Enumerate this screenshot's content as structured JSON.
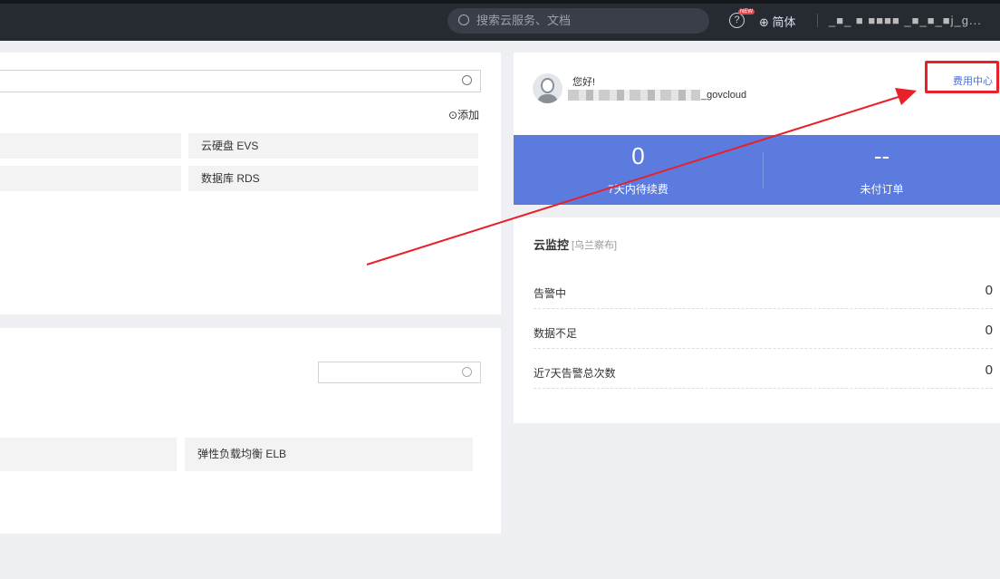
{
  "topbar": {
    "search_placeholder": "搜索云服务、文档",
    "new_badge": "NEW",
    "help_icon": "?",
    "language": "简体",
    "username": "_■_ ■ ■■■■ _■_■_■j_g..."
  },
  "left_panel": {
    "add_label": "添加",
    "services": [
      "云硬盘 EVS",
      "数据库 RDS"
    ]
  },
  "left_panel2": {
    "services": [
      "弹性负载均衡 ELB"
    ]
  },
  "account": {
    "greeting": "您好!",
    "username_suffix": "_govcloud",
    "fee_center_link": "费用中心",
    "stats": [
      {
        "value": "0",
        "label": "7天内待续费"
      },
      {
        "value": "--",
        "label": "未付订单"
      }
    ]
  },
  "monitor": {
    "title": "云监控",
    "region": "[乌兰察布]",
    "rows": [
      {
        "label": "告警中",
        "value": "0"
      },
      {
        "label": "数据不足",
        "value": "0"
      },
      {
        "label": "近7天告警总次数",
        "value": "0"
      }
    ]
  },
  "colors": {
    "accent_blue": "#5b7bdf",
    "annotation_red": "#e8202a",
    "link_blue": "#4a6fd6"
  }
}
